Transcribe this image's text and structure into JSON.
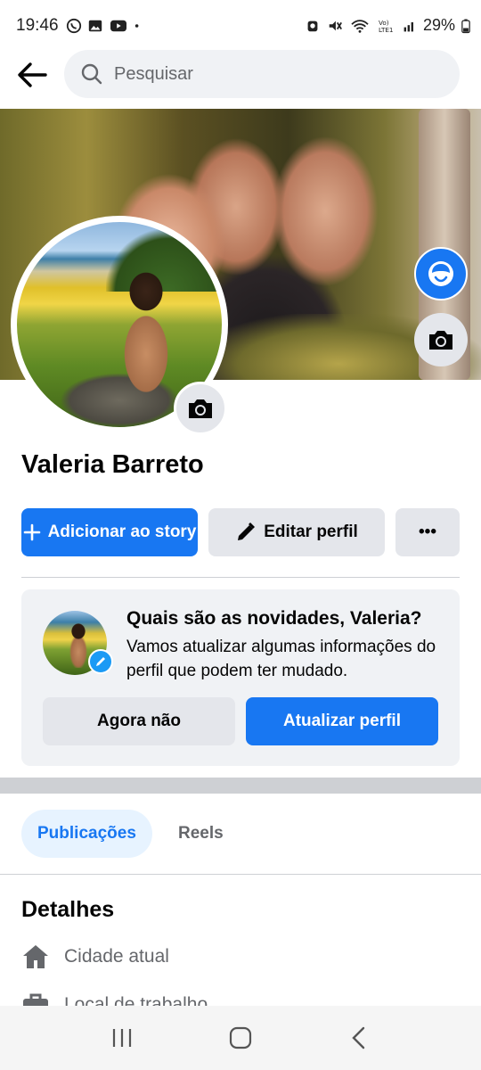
{
  "status_bar": {
    "time": "19:46",
    "battery": "29%",
    "left_icons": [
      "whatsapp-icon",
      "gallery-icon",
      "youtube-icon",
      "dot-icon"
    ],
    "right_icons": [
      "alarm-icon",
      "mute-icon",
      "wifi-icon",
      "volte-icon",
      "signal-icon",
      "battery-icon"
    ]
  },
  "header": {
    "search_placeholder": "Pesquisar"
  },
  "profile": {
    "name": "Valeria Barreto"
  },
  "actions": {
    "add_story_label": "Adicionar ao story",
    "edit_profile_label": "Editar perfil",
    "more_label": "•••"
  },
  "update_card": {
    "title": "Quais são as novidades, Valeria?",
    "description": "Vamos atualizar algumas informações do perfil que podem ter mudado.",
    "later_label": "Agora não",
    "update_label": "Atualizar perfil"
  },
  "tabs": [
    {
      "label": "Publicações",
      "active": true
    },
    {
      "label": "Reels",
      "active": false
    }
  ],
  "details": {
    "title": "Detalhes",
    "items": [
      {
        "icon": "home-icon",
        "label": "Cidade atual"
      },
      {
        "icon": "briefcase-icon",
        "label": "Local de trabalho"
      }
    ]
  },
  "colors": {
    "accent": "#1877f2",
    "secondary_button": "#e4e6eb",
    "card_background": "#f0f2f5",
    "text_secondary": "#65676b"
  }
}
